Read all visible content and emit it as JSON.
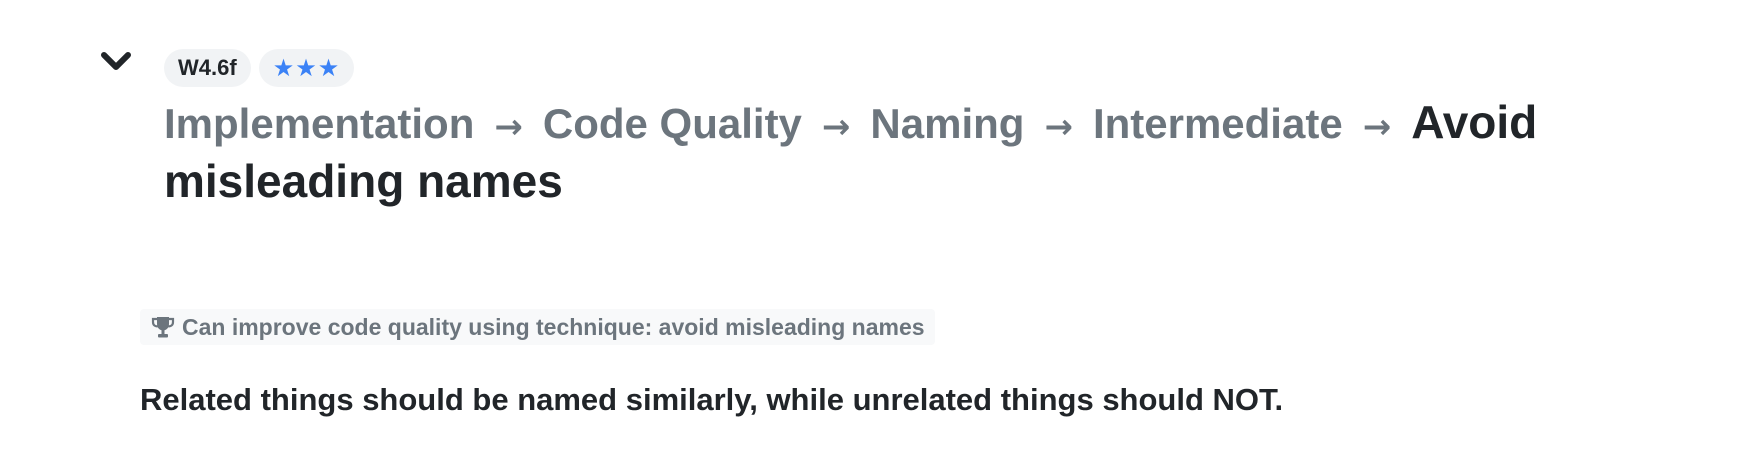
{
  "header": {
    "id_badge": "W4.6f",
    "stars": "★★★",
    "breadcrumb": [
      "Implementation",
      "Code Quality",
      "Naming",
      "Intermediate"
    ],
    "separator": "→",
    "current": "Avoid misleading names"
  },
  "achievement": {
    "icon": "trophy-icon",
    "text": "Can improve code quality using technique: avoid misleading names"
  },
  "description": "Related things should be named similarly, while unrelated things should NOT.",
  "colors": {
    "star": "#3b82f6",
    "muted_text": "#6c757d",
    "main_text": "#212529"
  }
}
